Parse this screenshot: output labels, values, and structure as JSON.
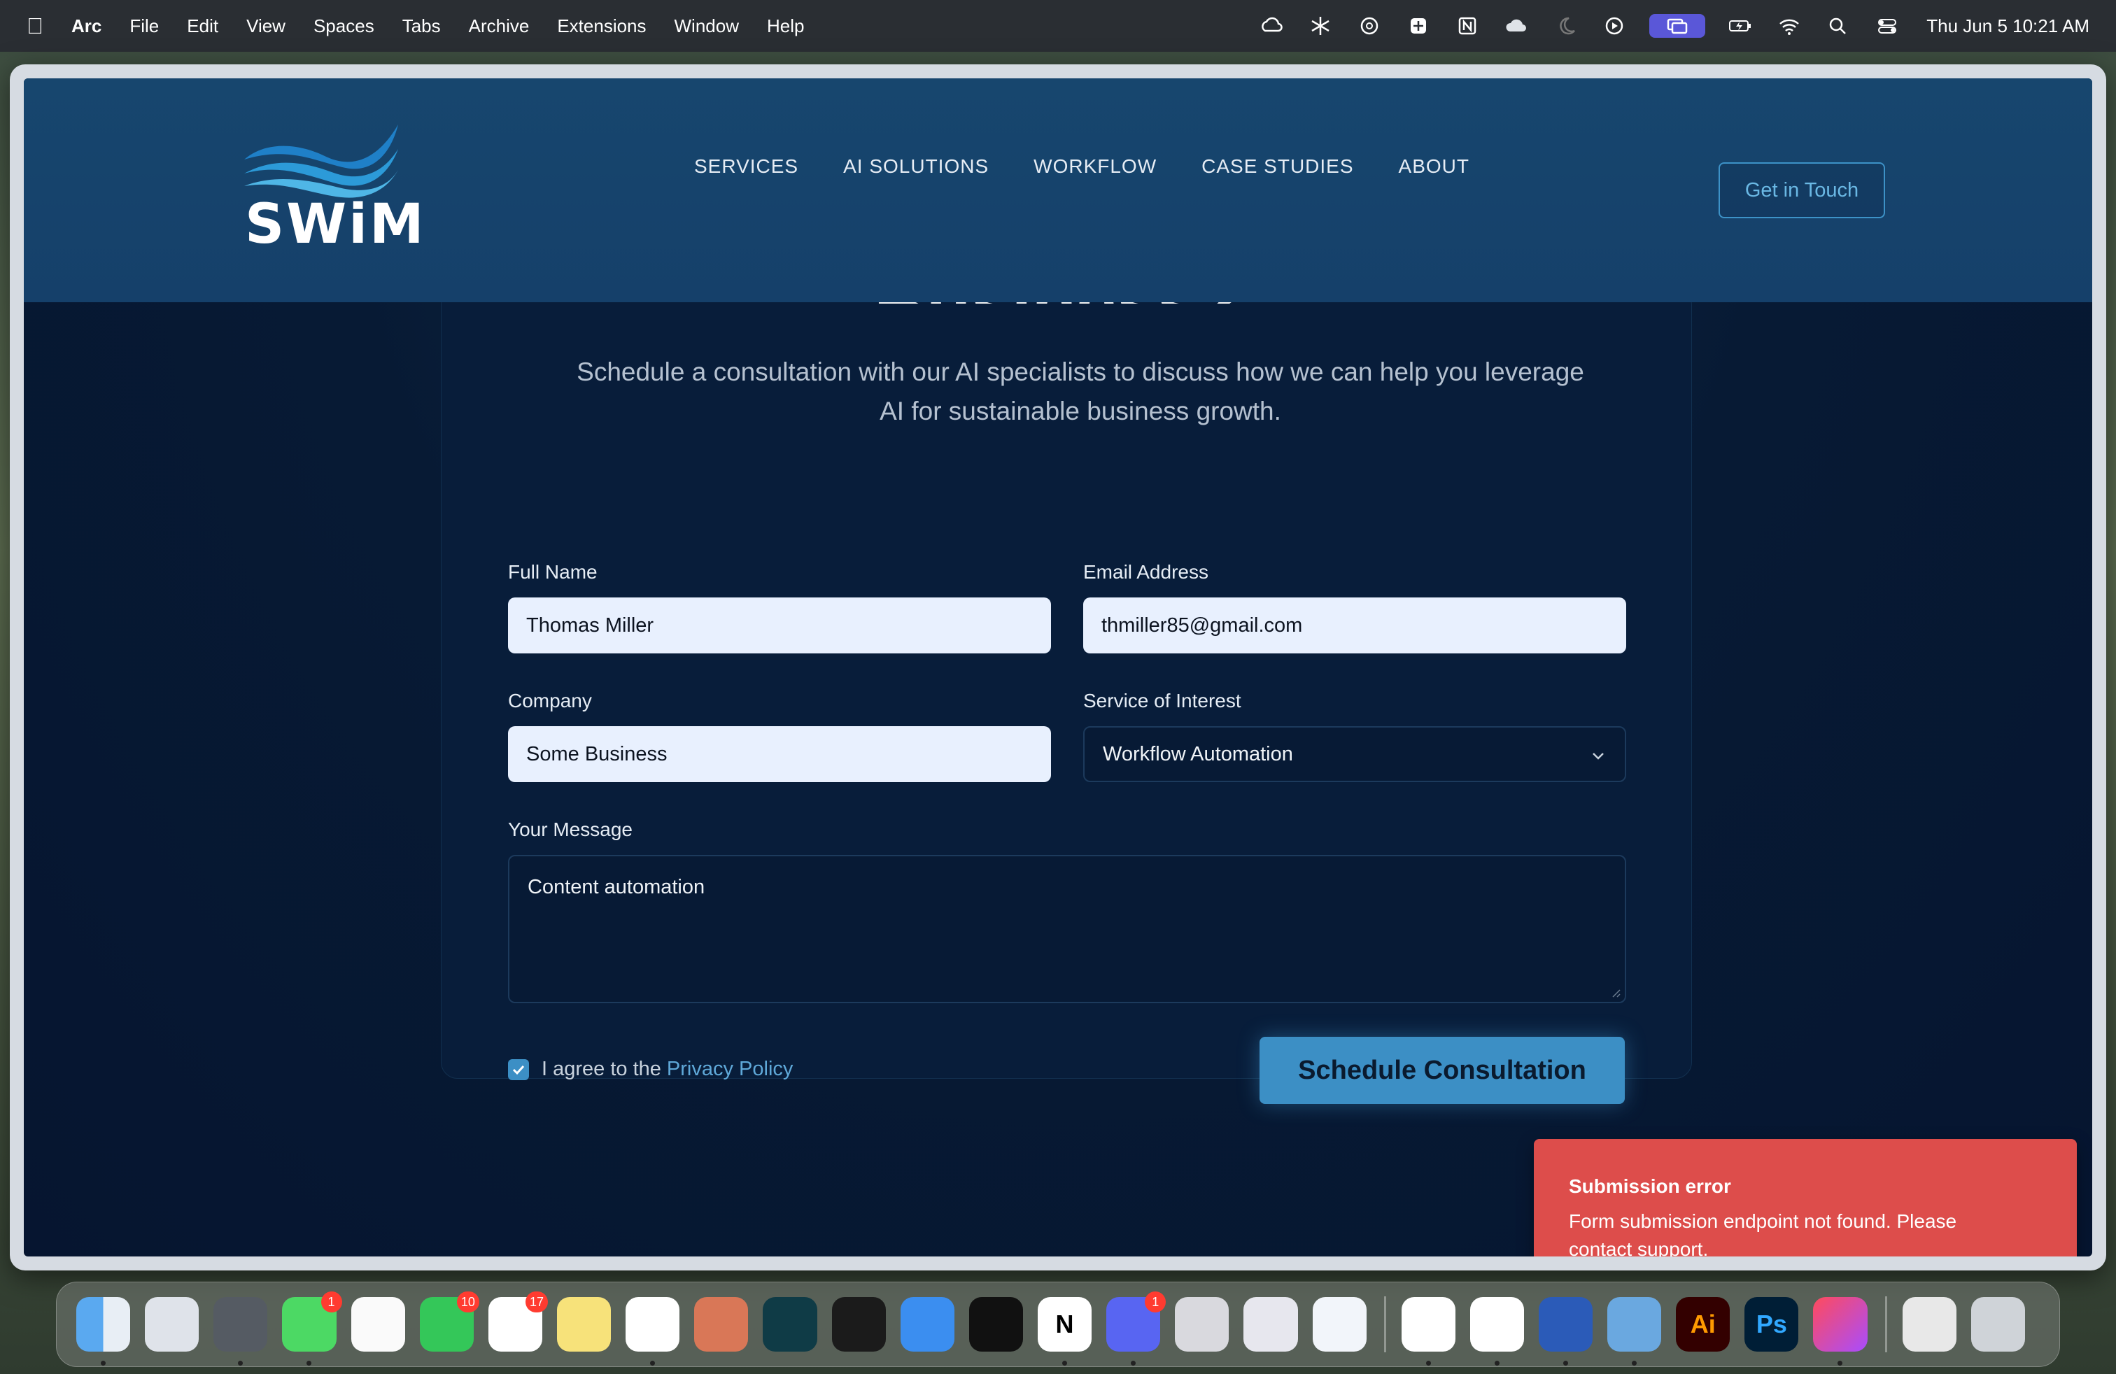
{
  "menubar": {
    "app_name": "Arc",
    "menus": [
      "File",
      "Edit",
      "View",
      "Spaces",
      "Tabs",
      "Archive",
      "Extensions",
      "Window",
      "Help"
    ],
    "clock": "Thu Jun 5  10:21 AM"
  },
  "site": {
    "logo_text": "SWiM",
    "nav": [
      "SERVICES",
      "AI SOLUTIONS",
      "WORKFLOW",
      "CASE STUDIES",
      "ABOUT"
    ],
    "cta": "Get in Touch"
  },
  "form": {
    "heading_partial": "Business?",
    "subtitle": "Schedule a consultation with our AI specialists to discuss how we can help you leverage AI for sustainable business growth.",
    "full_name": {
      "label": "Full Name",
      "value": "Thomas Miller"
    },
    "email": {
      "label": "Email Address",
      "value": "thmiller85@gmail.com"
    },
    "company": {
      "label": "Company",
      "value": "Some Business"
    },
    "service": {
      "label": "Service of Interest",
      "value": "Workflow Automation"
    },
    "message": {
      "label": "Your Message",
      "value": "Content automation"
    },
    "agree_text": "I agree to the",
    "privacy_link": "Privacy Policy",
    "agree_checked": true,
    "submit": "Schedule Consultation"
  },
  "toast": {
    "title": "Submission error",
    "body": "Form submission endpoint not found. Please contact support."
  },
  "dock": {
    "badges": {
      "messages": "1",
      "facetime": "10",
      "reminders": "17",
      "discord": "1"
    },
    "labels": {
      "illustrator": "Ai",
      "photoshop": "Ps"
    }
  },
  "colors": {
    "accent": "#3c8fc5",
    "toast_bg": "#dd4d4b",
    "page_bg": "#071a34"
  }
}
